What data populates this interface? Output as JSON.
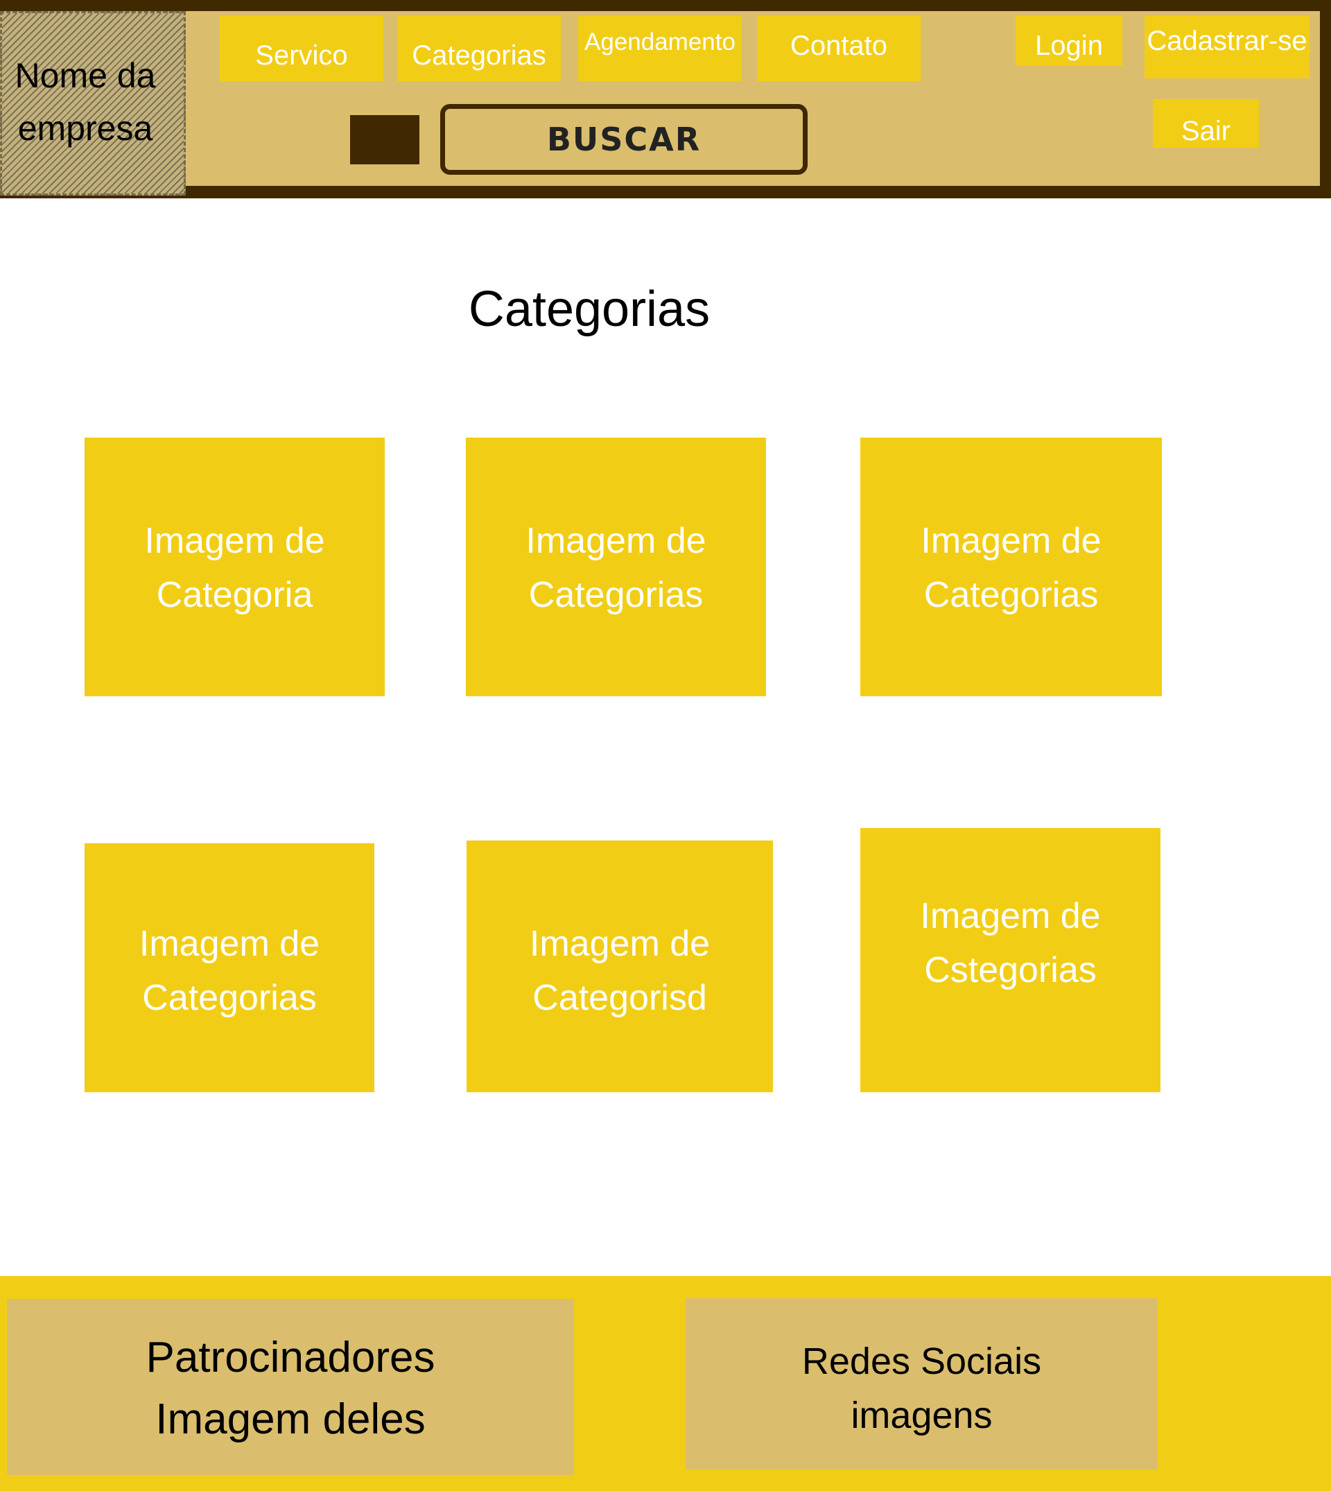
{
  "header": {
    "logo_text": "Nome da\nempresa",
    "nav": {
      "servico": "Servico",
      "categorias": "Categorias",
      "agendamento": "Agendamento",
      "contato": "Contato",
      "login": "Login",
      "cadastrar": "Cadastrar-se",
      "sair": "Sair"
    },
    "search_label": "BUSCAR"
  },
  "main": {
    "title": "Categorias",
    "cards": [
      {
        "label": "Imagem de\nCategoria"
      },
      {
        "label": "Imagem de\nCategorias"
      },
      {
        "label": "Imagem de\nCategorias"
      },
      {
        "label": "Imagem de\nCategorias"
      },
      {
        "label": "Imagem de\nCategorisd"
      },
      {
        "label": "Imagem de\nCstegorias"
      }
    ]
  },
  "footer": {
    "sponsors": "Patrocinadores\n Imagem deles",
    "social": "Redes Sociais\nimagens"
  },
  "colors": {
    "dark_brown": "#402800",
    "tan": "#dabe6e",
    "yellow": "#f2cd16",
    "white": "#ffffff"
  }
}
